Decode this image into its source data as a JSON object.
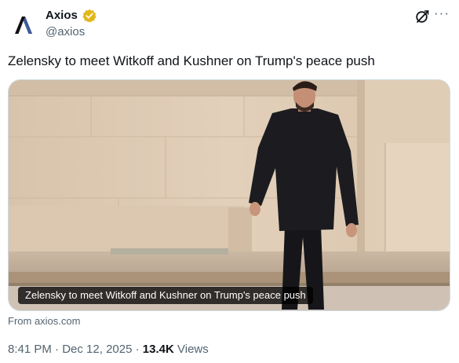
{
  "author": {
    "name": "Axios",
    "handle": "@axios",
    "verified": true,
    "badge_color": "#e2b719",
    "logo_icon": "axios-logo-icon"
  },
  "header_actions": {
    "grok_icon": "grok-icon",
    "more_icon": "more-icon",
    "more_label": "···"
  },
  "tweet": {
    "text": "Zelensky to meet Witkoff and Kushner on Trump's peace push"
  },
  "link_card": {
    "image_caption": "Zelensky to meet Witkoff and Kushner on Trump's peace push",
    "source": "From axios.com"
  },
  "meta": {
    "time": "8:41 PM",
    "separator": "·",
    "date": "Dec 12, 2025",
    "views_count": "13.4K",
    "views_label": "Views"
  },
  "colors": {
    "text_primary": "#0f1419",
    "text_secondary": "#536471",
    "border": "#cfd9de"
  }
}
